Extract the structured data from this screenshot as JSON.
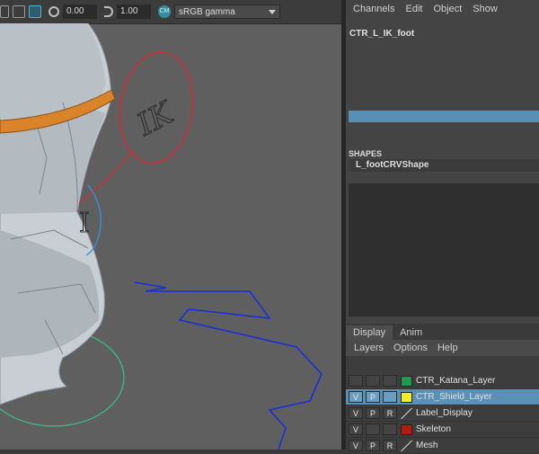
{
  "viewport": {
    "exposure_value": "0.00",
    "gamma_value": "1.00",
    "color_management_badge": "CM",
    "colorspace_value": "sRGB gamma",
    "ik_label": "IK",
    "control_label": "I",
    "icons": [
      "toolbar-icon-a",
      "toolbar-icon-b",
      "toolbar-icon-c",
      "exposure-icon",
      "gamma-icon",
      "color-management-icon"
    ]
  },
  "channel_box": {
    "menu": [
      "Channels",
      "Edit",
      "Object",
      "Show"
    ],
    "object_name": "CTR_L_IK_foot",
    "shapes_title": "SHAPES",
    "shape_name": "L_footCRVShape"
  },
  "layers": {
    "tabs": [
      "Display",
      "Anim"
    ],
    "active_tab": "Display",
    "menu": [
      "Layers",
      "Options",
      "Help"
    ],
    "rows": [
      {
        "v": "",
        "p": "",
        "r": "",
        "color": "#1f9a52",
        "name": "CTR_Katana_Layer",
        "selected": false
      },
      {
        "v": "V",
        "p": "P",
        "r": "",
        "color": "#f2ee1f",
        "name": "CTR_Shield_Layer",
        "selected": true
      },
      {
        "v": "V",
        "p": "P",
        "r": "R",
        "color": "",
        "name": "Label_Display",
        "selected": false
      },
      {
        "v": "V",
        "p": "",
        "r": "",
        "color": "#b01d0e",
        "name": "Skeleton",
        "selected": false
      },
      {
        "v": "V",
        "p": "P",
        "r": "R",
        "color": "",
        "name": "Mesh",
        "selected": false
      }
    ]
  }
}
